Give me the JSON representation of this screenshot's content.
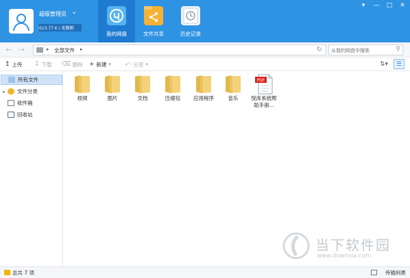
{
  "header": {
    "username": "超级管理员",
    "quota_text": "613.77 K / 无限制",
    "quota_fraction": 0.01,
    "nav_tabs": [
      {
        "label": "我的网盘",
        "icon": "cloud-disk-icon",
        "active": true
      },
      {
        "label": "文件共享",
        "icon": "share-folder-icon",
        "active": false
      },
      {
        "label": "历史记录",
        "icon": "history-clock-icon",
        "active": false
      }
    ],
    "colors": {
      "header_bg": "#2f93e3",
      "active_tab_bg": "#1f7bd1"
    }
  },
  "address_bar": {
    "path_label": "全部文件",
    "search_placeholder": "从我的网盘中搜索"
  },
  "toolbar": {
    "upload": "上传",
    "download": "下载",
    "delete": "删除",
    "new": "新建",
    "share": "分享"
  },
  "sidebar": {
    "items": [
      {
        "label": "所有文件",
        "icon": "all-files-icon",
        "active": true
      },
      {
        "label": "文件分类",
        "icon": "category-icon",
        "active": false
      },
      {
        "label": "收件箱",
        "icon": "inbox-icon",
        "active": false
      },
      {
        "label": "回收站",
        "icon": "recycle-bin-icon",
        "active": false
      }
    ]
  },
  "files": [
    {
      "name": "视频",
      "type": "folder"
    },
    {
      "name": "图片",
      "type": "folder"
    },
    {
      "name": "文档",
      "type": "folder"
    },
    {
      "name": "压缩包",
      "type": "folder"
    },
    {
      "name": "应用程序",
      "type": "folder"
    },
    {
      "name": "音乐",
      "type": "folder"
    },
    {
      "name": "悦库系统帮助手册...",
      "type": "pdf",
      "badge": "PDF"
    }
  ],
  "watermark": {
    "title": "当下软件园",
    "url": "www.downxia.com"
  },
  "status": {
    "total": "总共 7 项",
    "transfer": "传输列表"
  }
}
